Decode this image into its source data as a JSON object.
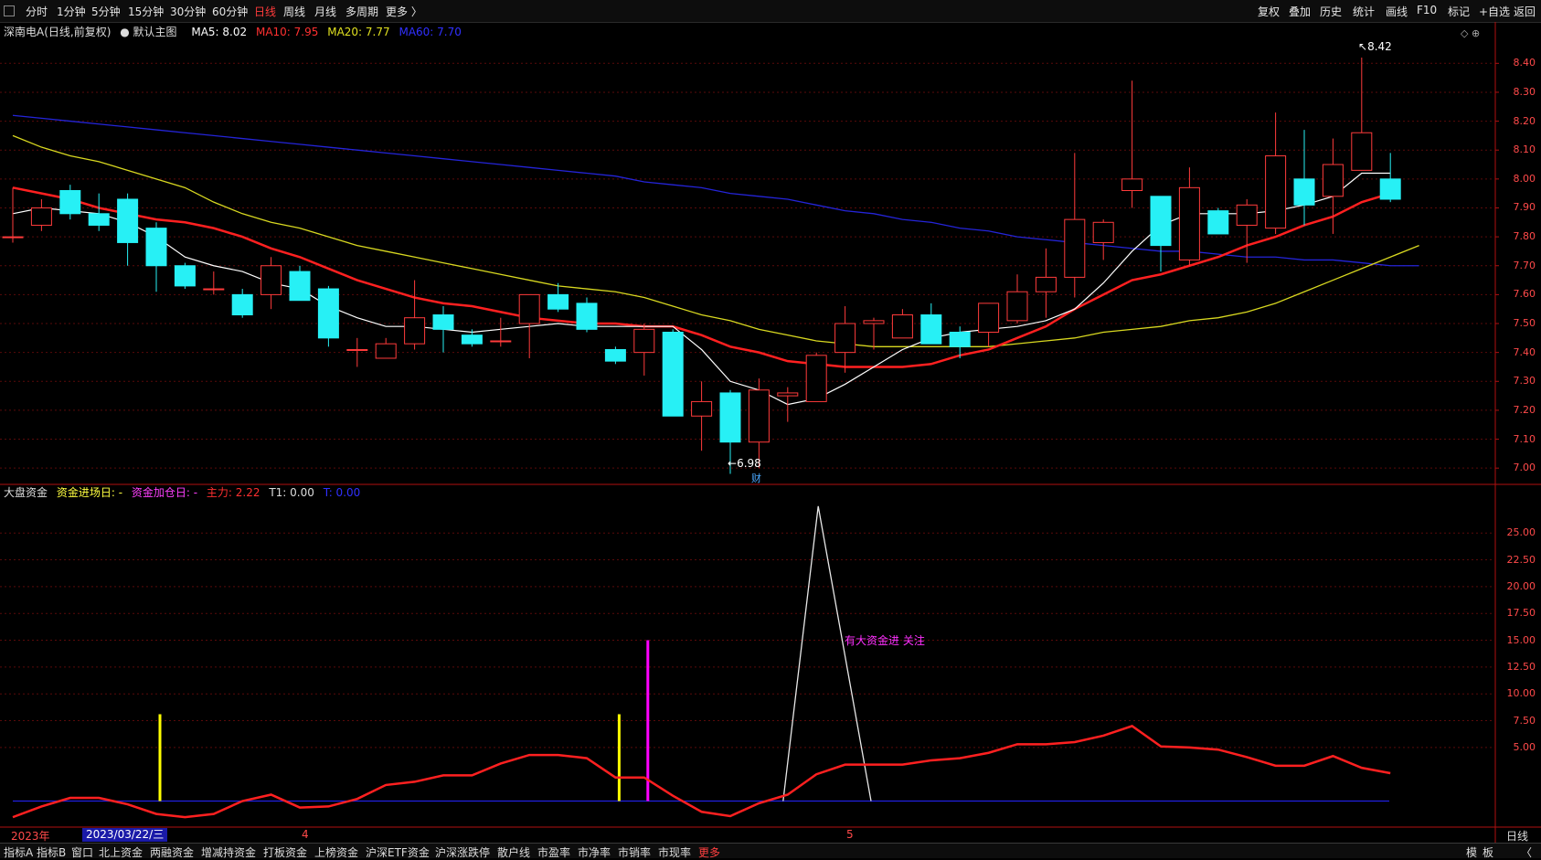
{
  "toolbar": {
    "periods": [
      "分时",
      "1分钟",
      "5分钟",
      "15分钟",
      "30分钟",
      "60分钟",
      "日线",
      "周线",
      "月线",
      "多周期",
      "更多 〉"
    ],
    "active_period": "日线",
    "right_buttons": [
      "复权",
      "叠加",
      "历史",
      "统计",
      "画线",
      "F10",
      "标记",
      "+自选",
      "返回"
    ]
  },
  "main": {
    "stock_name": "深南电A(日线,前复权)",
    "chart_name": "默认主图",
    "ma5_label": "MA5: 8.02",
    "ma10_label": "MA10: 7.95",
    "ma20_label": "MA20: 7.77",
    "ma60_label": "MA60: 7.70",
    "high_marker": "8.42",
    "low_marker": "6.98",
    "low_flag": "财",
    "price_ticks": [
      "8.40",
      "8.30",
      "8.20",
      "8.10",
      "8.00",
      "7.90",
      "7.80",
      "7.70",
      "7.60",
      "7.50",
      "7.40",
      "7.30",
      "7.20",
      "7.10",
      "7.00"
    ]
  },
  "sub": {
    "indicator_name": "大盘资金",
    "inflow_day_label": "资金进场日: -",
    "add_day_label": "资金加仓日: -",
    "main_force_label": "主力: 2.22",
    "t1_label": "T1: 0.00",
    "t_label": "T: 0.00",
    "signal_text": "有大资金进 关注",
    "ticks": [
      "25.00",
      "22.50",
      "20.00",
      "17.50",
      "15.00",
      "12.50",
      "10.00",
      "7.50",
      "5.00"
    ]
  },
  "timeline": {
    "year_label": "2023年",
    "cursor_date": "2023/03/22/三",
    "month4": "4",
    "month5": "5",
    "period_right": "日线"
  },
  "bottom_tabs": [
    "指标A",
    "指标B",
    "窗口",
    "北上资金",
    "两融资金",
    "增减持资金",
    "打板资金",
    "上榜资金",
    "沪深ETF资金",
    "沪深涨跌停",
    "散户线",
    "市盈率",
    "市净率",
    "市销率",
    "市现率",
    "更多"
  ],
  "bottom_right": [
    "模",
    "板",
    "〈"
  ],
  "colors": {
    "up": "#ff3b3b",
    "down": "#27f0f5",
    "ma5": "#ffffff",
    "ma10": "#ff2020",
    "ma20": "#d8d820",
    "ma60": "#2424d8",
    "main_force": "#ff2020",
    "yellow_bar": "#ffff00",
    "magenta_bar": "#ff00ff"
  },
  "chart_data": {
    "type": "candlestick",
    "ylim": [
      6.95,
      8.48
    ],
    "candles": [
      {
        "o": 7.8,
        "h": 7.97,
        "l": 7.78,
        "c": 7.8
      },
      {
        "o": 7.84,
        "h": 7.93,
        "l": 7.82,
        "c": 7.9
      },
      {
        "o": 7.96,
        "h": 7.98,
        "l": 7.86,
        "c": 7.88
      },
      {
        "o": 7.88,
        "h": 7.95,
        "l": 7.82,
        "c": 7.84
      },
      {
        "o": 7.93,
        "h": 7.95,
        "l": 7.7,
        "c": 7.78
      },
      {
        "o": 7.83,
        "h": 7.85,
        "l": 7.61,
        "c": 7.7
      },
      {
        "o": 7.7,
        "h": 7.71,
        "l": 7.62,
        "c": 7.63
      },
      {
        "o": 7.62,
        "h": 7.68,
        "l": 7.6,
        "c": 7.62
      },
      {
        "o": 7.6,
        "h": 7.62,
        "l": 7.52,
        "c": 7.53
      },
      {
        "o": 7.6,
        "h": 7.73,
        "l": 7.55,
        "c": 7.7
      },
      {
        "o": 7.68,
        "h": 7.7,
        "l": 7.58,
        "c": 7.58
      },
      {
        "o": 7.62,
        "h": 7.63,
        "l": 7.42,
        "c": 7.45
      },
      {
        "o": 7.41,
        "h": 7.45,
        "l": 7.35,
        "c": 7.41
      },
      {
        "o": 7.38,
        "h": 7.45,
        "l": 7.38,
        "c": 7.43
      },
      {
        "o": 7.43,
        "h": 7.65,
        "l": 7.41,
        "c": 7.52
      },
      {
        "o": 7.53,
        "h": 7.56,
        "l": 7.4,
        "c": 7.48
      },
      {
        "o": 7.46,
        "h": 7.48,
        "l": 7.42,
        "c": 7.43
      },
      {
        "o": 7.44,
        "h": 7.52,
        "l": 7.42,
        "c": 7.44
      },
      {
        "o": 7.5,
        "h": 7.6,
        "l": 7.38,
        "c": 7.6
      },
      {
        "o": 7.6,
        "h": 7.64,
        "l": 7.54,
        "c": 7.55
      },
      {
        "o": 7.57,
        "h": 7.59,
        "l": 7.47,
        "c": 7.48
      },
      {
        "o": 7.41,
        "h": 7.42,
        "l": 7.36,
        "c": 7.37
      },
      {
        "o": 7.4,
        "h": 7.5,
        "l": 7.32,
        "c": 7.48
      },
      {
        "o": 7.47,
        "h": 7.48,
        "l": 7.18,
        "c": 7.18
      },
      {
        "o": 7.18,
        "h": 7.3,
        "l": 7.06,
        "c": 7.23
      },
      {
        "o": 7.26,
        "h": 7.27,
        "l": 6.98,
        "c": 7.09
      },
      {
        "o": 7.09,
        "h": 7.31,
        "l": 7.0,
        "c": 7.27
      },
      {
        "o": 7.25,
        "h": 7.28,
        "l": 7.16,
        "c": 7.26
      },
      {
        "o": 7.23,
        "h": 7.4,
        "l": 7.23,
        "c": 7.39
      },
      {
        "o": 7.4,
        "h": 7.56,
        "l": 7.33,
        "c": 7.5
      },
      {
        "o": 7.5,
        "h": 7.52,
        "l": 7.41,
        "c": 7.51
      },
      {
        "o": 7.45,
        "h": 7.55,
        "l": 7.45,
        "c": 7.53
      },
      {
        "o": 7.53,
        "h": 7.57,
        "l": 7.43,
        "c": 7.43
      },
      {
        "o": 7.47,
        "h": 7.49,
        "l": 7.38,
        "c": 7.42
      },
      {
        "o": 7.47,
        "h": 7.57,
        "l": 7.42,
        "c": 7.57
      },
      {
        "o": 7.51,
        "h": 7.67,
        "l": 7.5,
        "c": 7.61
      },
      {
        "o": 7.61,
        "h": 7.76,
        "l": 7.52,
        "c": 7.66
      },
      {
        "o": 7.66,
        "h": 8.09,
        "l": 7.59,
        "c": 7.86
      },
      {
        "o": 7.78,
        "h": 7.86,
        "l": 7.72,
        "c": 7.85
      },
      {
        "o": 7.96,
        "h": 8.34,
        "l": 7.9,
        "c": 8.0
      },
      {
        "o": 7.94,
        "h": 7.94,
        "l": 7.68,
        "c": 7.77
      },
      {
        "o": 7.72,
        "h": 8.04,
        "l": 7.7,
        "c": 7.97
      },
      {
        "o": 7.89,
        "h": 7.9,
        "l": 7.81,
        "c": 7.81
      },
      {
        "o": 7.84,
        "h": 7.93,
        "l": 7.71,
        "c": 7.91
      },
      {
        "o": 7.83,
        "h": 8.23,
        "l": 7.81,
        "c": 8.08
      },
      {
        "o": 8.0,
        "h": 8.17,
        "l": 7.84,
        "c": 7.91
      },
      {
        "o": 7.94,
        "h": 8.14,
        "l": 7.81,
        "c": 8.05
      },
      {
        "o": 8.03,
        "h": 8.42,
        "l": 8.03,
        "c": 8.16
      },
      {
        "o": 8.0,
        "h": 8.09,
        "l": 7.92,
        "c": 7.93
      }
    ],
    "ma5": [
      7.88,
      7.9,
      7.89,
      7.88,
      7.85,
      7.8,
      7.73,
      7.7,
      7.68,
      7.64,
      7.62,
      7.56,
      7.52,
      7.49,
      7.49,
      7.48,
      7.47,
      7.48,
      7.49,
      7.5,
      7.49,
      7.49,
      7.49,
      7.49,
      7.41,
      7.3,
      7.27,
      7.22,
      7.24,
      7.29,
      7.35,
      7.41,
      7.45,
      7.47,
      7.48,
      7.49,
      7.51,
      7.55,
      7.64,
      7.75,
      7.84,
      7.88,
      7.88,
      7.88,
      7.89,
      7.91,
      7.94,
      8.02,
      8.02
    ],
    "ma10": [
      7.97,
      7.95,
      7.93,
      7.9,
      7.88,
      7.86,
      7.85,
      7.83,
      7.8,
      7.76,
      7.73,
      7.69,
      7.65,
      7.62,
      7.59,
      7.57,
      7.56,
      7.54,
      7.52,
      7.51,
      7.5,
      7.5,
      7.49,
      7.49,
      7.46,
      7.42,
      7.4,
      7.37,
      7.36,
      7.35,
      7.35,
      7.35,
      7.36,
      7.39,
      7.41,
      7.45,
      7.49,
      7.55,
      7.6,
      7.65,
      7.67,
      7.7,
      7.73,
      7.77,
      7.8,
      7.84,
      7.87,
      7.92,
      7.95
    ],
    "ma20": [
      8.15,
      8.11,
      8.08,
      8.06,
      8.03,
      8.0,
      7.97,
      7.92,
      7.88,
      7.85,
      7.83,
      7.8,
      7.77,
      7.75,
      7.73,
      7.71,
      7.69,
      7.67,
      7.65,
      7.63,
      7.62,
      7.61,
      7.59,
      7.56,
      7.53,
      7.51,
      7.48,
      7.46,
      7.44,
      7.43,
      7.42,
      7.42,
      7.42,
      7.42,
      7.42,
      7.43,
      7.44,
      7.45,
      7.47,
      7.48,
      7.49,
      7.51,
      7.52,
      7.54,
      7.57,
      7.61,
      7.65,
      7.69,
      7.73,
      7.77
    ],
    "ma60": [
      8.22,
      8.21,
      8.2,
      8.19,
      8.18,
      8.17,
      8.16,
      8.15,
      8.14,
      8.13,
      8.12,
      8.11,
      8.1,
      8.09,
      8.08,
      8.07,
      8.06,
      8.05,
      8.04,
      8.03,
      8.02,
      8.01,
      7.99,
      7.98,
      7.97,
      7.95,
      7.94,
      7.93,
      7.91,
      7.89,
      7.88,
      7.86,
      7.85,
      7.83,
      7.82,
      7.8,
      7.79,
      7.78,
      7.77,
      7.76,
      7.75,
      7.75,
      7.74,
      7.73,
      7.73,
      7.72,
      7.72,
      7.71,
      7.7,
      7.7
    ],
    "sub_ylim": [
      -2,
      28
    ],
    "main_force": [
      -1.5,
      -0.5,
      0.3,
      0.3,
      -0.3,
      -1.2,
      -1.5,
      -1.2,
      0.0,
      0.6,
      -0.6,
      -0.5,
      0.2,
      1.5,
      1.8,
      2.4,
      2.4,
      3.5,
      4.3,
      4.3,
      4.0,
      2.2,
      2.2,
      0.5,
      -1.0,
      -1.4,
      -0.2,
      0.6,
      2.5,
      3.4,
      3.4,
      3.4,
      3.8,
      4.0,
      4.5,
      5.3,
      5.3,
      5.5,
      6.1,
      7.0,
      5.1,
      5.0,
      4.8,
      4.1,
      3.3,
      3.3,
      4.2,
      3.1,
      2.6
    ],
    "yellow_bars": [
      {
        "i": 5,
        "v": 8.1
      },
      {
        "i": 21,
        "v": 8.1
      }
    ],
    "magenta_bars": [
      {
        "i": 22,
        "v": 15.0
      }
    ],
    "white_spike": {
      "i0": 27,
      "peak": 28,
      "i1": 30,
      "v": 27.5
    }
  }
}
